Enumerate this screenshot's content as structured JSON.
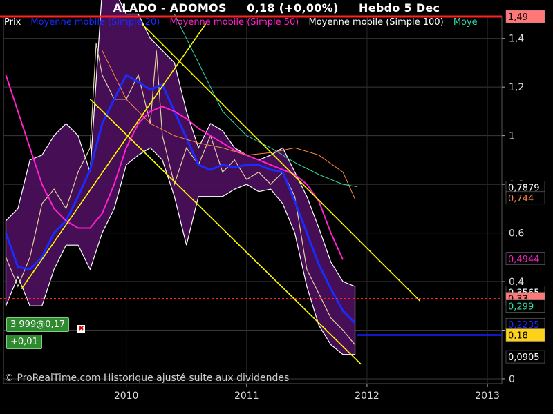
{
  "header": {
    "symbol": "ALADO - ADOMOS",
    "quote": "0,18 (+0,00%)",
    "period": "Hebdo  5 Dec"
  },
  "legend": [
    {
      "label": "Prix",
      "color": "#ffffff"
    },
    {
      "label": "Moyenne mobile (Simple 20)",
      "color": "#1a2bff"
    },
    {
      "label": "Moyenne mobile (Simple 50)",
      "color": "#ff22cc"
    },
    {
      "label": "Moyenne mobile (Simple 100)",
      "color": "#ffffff"
    },
    {
      "label": "Moye",
      "color": "#33ddaa"
    }
  ],
  "position_badge": {
    "quantity": "3 999@0,17",
    "pnl": "+0,01"
  },
  "copyright": "© ProRealTime.com Historique ajusté suite aux dividendes",
  "colors": {
    "background": "#000000",
    "price": "#e0d0a0",
    "bollinger_fill": "#4a0f5a",
    "ma20": "#1a2bff",
    "ma50": "#ff22cc",
    "ma100": "#ff8844",
    "ma_extra": "#33ddaa",
    "trendline": "#ffff00",
    "level_line": "#ff2222",
    "current_price_line": "#1122ff"
  },
  "chart_data": {
    "type": "line",
    "x_ticks": [
      "2010",
      "2011",
      "2012",
      "2013"
    ],
    "x_tick_dates": [
      2010.0,
      2011.0,
      2012.0,
      2013.0
    ],
    "xlim": [
      2008.98,
      2013.12
    ],
    "ylim": [
      -0.02,
      1.49
    ],
    "y_ticks": [
      "0",
      "0,2",
      "0,4",
      "0,6",
      "0,8",
      "1",
      "1,2",
      "1,4"
    ],
    "y_tick_values": [
      0,
      0.2,
      0.4,
      0.6,
      0.8,
      1.0,
      1.2,
      1.4
    ],
    "series": [
      {
        "name": "Prix",
        "key": "price",
        "x": [
          2009.0,
          2009.1,
          2009.2,
          2009.3,
          2009.4,
          2009.5,
          2009.6,
          2009.7,
          2009.75,
          2009.8,
          2009.9,
          2010.0,
          2010.1,
          2010.2,
          2010.25,
          2010.3,
          2010.4,
          2010.5,
          2010.6,
          2010.7,
          2010.8,
          2010.9,
          2011.0,
          2011.1,
          2011.2,
          2011.3,
          2011.4,
          2011.5,
          2011.6,
          2011.7,
          2011.8,
          2011.9
        ],
        "y": [
          0.5,
          0.38,
          0.5,
          0.72,
          0.78,
          0.7,
          0.85,
          0.95,
          1.38,
          1.25,
          1.15,
          1.15,
          1.25,
          1.05,
          1.35,
          1.0,
          0.8,
          0.95,
          0.88,
          1.0,
          0.85,
          0.9,
          0.82,
          0.85,
          0.8,
          0.85,
          0.75,
          0.45,
          0.35,
          0.25,
          0.2,
          0.14
        ]
      },
      {
        "name": "Moyenne mobile (Simple 20)",
        "key": "ma20",
        "x": [
          2009.0,
          2009.1,
          2009.2,
          2009.3,
          2009.4,
          2009.5,
          2009.6,
          2009.7,
          2009.8,
          2009.9,
          2010.0,
          2010.1,
          2010.2,
          2010.3,
          2010.4,
          2010.5,
          2010.6,
          2010.7,
          2010.8,
          2010.9,
          2011.0,
          2011.1,
          2011.2,
          2011.3,
          2011.4,
          2011.5,
          2011.6,
          2011.7,
          2011.8,
          2011.9
        ],
        "y": [
          0.6,
          0.46,
          0.45,
          0.5,
          0.6,
          0.65,
          0.75,
          0.86,
          1.05,
          1.15,
          1.25,
          1.22,
          1.19,
          1.21,
          1.1,
          0.99,
          0.88,
          0.86,
          0.88,
          0.87,
          0.88,
          0.88,
          0.86,
          0.85,
          0.73,
          0.6,
          0.47,
          0.37,
          0.28,
          0.23
        ]
      },
      {
        "name": "Moyenne mobile (Simple 50)",
        "key": "ma50",
        "x": [
          2009.0,
          2009.1,
          2009.2,
          2009.3,
          2009.4,
          2009.5,
          2009.6,
          2009.7,
          2009.8,
          2009.9,
          2010.0,
          2010.1,
          2010.2,
          2010.3,
          2010.4,
          2010.5,
          2010.6,
          2010.7,
          2010.8,
          2010.9,
          2011.0,
          2011.1,
          2011.2,
          2011.3,
          2011.4,
          2011.5,
          2011.6,
          2011.7,
          2011.8
        ],
        "y": [
          1.25,
          1.1,
          0.95,
          0.8,
          0.7,
          0.65,
          0.62,
          0.62,
          0.68,
          0.8,
          0.95,
          1.05,
          1.1,
          1.12,
          1.1,
          1.07,
          1.03,
          1.0,
          0.97,
          0.94,
          0.92,
          0.9,
          0.88,
          0.86,
          0.84,
          0.8,
          0.73,
          0.6,
          0.49
        ]
      },
      {
        "name": "Moyenne mobile (Simple 100)",
        "key": "ma100",
        "x": [
          2009.8,
          2010.0,
          2010.2,
          2010.4,
          2010.6,
          2010.8,
          2011.0,
          2011.2,
          2011.4,
          2011.6,
          2011.8,
          2011.9
        ],
        "y": [
          1.35,
          1.15,
          1.05,
          1.0,
          0.97,
          0.95,
          0.92,
          0.93,
          0.95,
          0.92,
          0.85,
          0.74
        ]
      },
      {
        "name": "Moye",
        "key": "ma_extra",
        "x": [
          2010.4,
          2010.6,
          2010.8,
          2011.0,
          2011.2,
          2011.4,
          2011.6,
          2011.8,
          2011.92
        ],
        "y": [
          1.5,
          1.3,
          1.1,
          1.0,
          0.95,
          0.89,
          0.84,
          0.8,
          0.79
        ]
      }
    ],
    "bollinger": {
      "x": [
        2009.0,
        2009.1,
        2009.2,
        2009.3,
        2009.4,
        2009.5,
        2009.6,
        2009.7,
        2009.8,
        2009.9,
        2010.0,
        2010.1,
        2010.2,
        2010.3,
        2010.4,
        2010.5,
        2010.6,
        2010.7,
        2010.8,
        2010.9,
        2011.0,
        2011.1,
        2011.2,
        2011.3,
        2011.4,
        2011.5,
        2011.6,
        2011.7,
        2011.8,
        2011.9
      ],
      "upper": [
        0.65,
        0.7,
        0.9,
        0.92,
        1.0,
        1.05,
        1.0,
        0.85,
        1.6,
        1.6,
        1.5,
        1.5,
        1.4,
        1.35,
        1.3,
        1.1,
        0.95,
        1.05,
        1.02,
        0.95,
        0.92,
        0.9,
        0.92,
        0.95,
        0.85,
        0.75,
        0.62,
        0.48,
        0.4,
        0.38
      ],
      "lower": [
        0.3,
        0.42,
        0.3,
        0.3,
        0.45,
        0.55,
        0.55,
        0.45,
        0.6,
        0.7,
        0.88,
        0.92,
        0.95,
        0.9,
        0.75,
        0.55,
        0.75,
        0.75,
        0.75,
        0.78,
        0.8,
        0.77,
        0.78,
        0.72,
        0.6,
        0.38,
        0.22,
        0.14,
        0.1,
        0.1
      ]
    },
    "trendlines": [
      {
        "from": [
          2009.13,
          0.37
        ],
        "to": [
          2010.66,
          1.46
        ]
      },
      {
        "from": [
          2010.13,
          1.46
        ],
        "to": [
          2012.44,
          0.32
        ]
      },
      {
        "from": [
          2009.7,
          1.15
        ],
        "to": [
          2011.95,
          0.06
        ]
      }
    ],
    "level_line": {
      "value": 0.33,
      "style": "dashed"
    },
    "current_price_line": {
      "value": 0.18,
      "from": 2011.92
    },
    "right_labels": [
      {
        "text": "1,49",
        "value": 1.49,
        "bg": "#ff7777",
        "fg": "#000000"
      },
      {
        "text": "0,7879",
        "value": 0.7879,
        "bg": "#000000",
        "fg": "#ffffff"
      },
      {
        "text": "0,744",
        "value": 0.744,
        "bg": "#000000",
        "fg": "#ff8844"
      },
      {
        "text": "0,4944",
        "value": 0.4944,
        "bg": "#000000",
        "fg": "#ff22cc"
      },
      {
        "text": "0,3565",
        "value": 0.3565,
        "bg": "#000000",
        "fg": "#ffffff"
      },
      {
        "text": "0,33",
        "value": 0.33,
        "bg": "#ff7777",
        "fg": "#000000"
      },
      {
        "text": "0,299",
        "value": 0.299,
        "bg": "#000000",
        "fg": "#33ddaa"
      },
      {
        "text": "0,2235",
        "value": 0.2235,
        "bg": "#000000",
        "fg": "#1a2bff"
      },
      {
        "text": "0,18",
        "value": 0.18,
        "bg": "#ffd21a",
        "fg": "#000000"
      },
      {
        "text": "0,0905",
        "value": 0.0905,
        "bg": "#000000",
        "fg": "#ffffff"
      }
    ]
  }
}
